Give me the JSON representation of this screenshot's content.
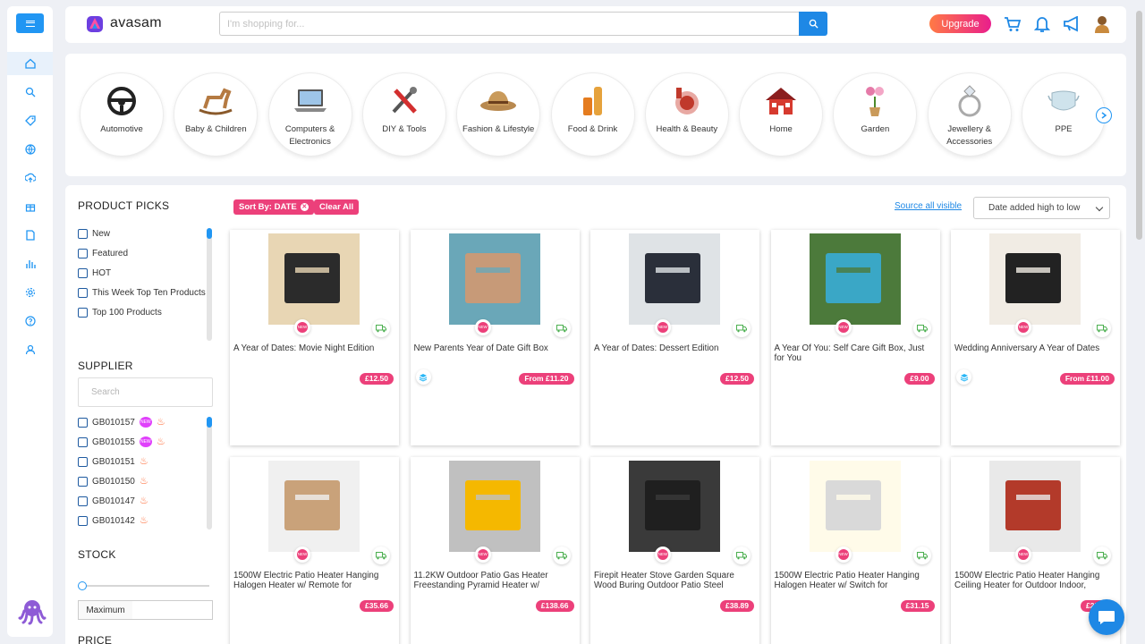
{
  "header": {
    "logo": "avasam",
    "search_placeholder": "I'm shopping for...",
    "upgrade": "Upgrade",
    "accent": "#1e88e5"
  },
  "nav_icons": [
    "home-icon",
    "search-icon",
    "tag-icon",
    "globe-icon",
    "upload-icon",
    "gift-icon",
    "document-icon",
    "chart-icon",
    "gear-icon",
    "help-icon",
    "user-icon"
  ],
  "categories": [
    {
      "label": "Automotive",
      "icon": "steering-wheel"
    },
    {
      "label": "Baby & Children",
      "icon": "rocking-horse"
    },
    {
      "label": "Computers & Electronics",
      "icon": "laptop"
    },
    {
      "label": "DIY & Tools",
      "icon": "tools"
    },
    {
      "label": "Fashion & Lifestyle",
      "icon": "hat"
    },
    {
      "label": "Food & Drink",
      "icon": "drinks"
    },
    {
      "label": "Health & Beauty",
      "icon": "cosmetics"
    },
    {
      "label": "Home",
      "icon": "house"
    },
    {
      "label": "Garden",
      "icon": "flowers"
    },
    {
      "label": "Jewellery & Accessories",
      "icon": "ring"
    },
    {
      "label": "PPE",
      "icon": "face-mask"
    }
  ],
  "filters": {
    "picks_title": "PRODUCT PICKS",
    "picks": [
      "New",
      "Featured",
      "HOT",
      "This Week Top Ten Products",
      "Top 100 Products"
    ],
    "supplier_title": "SUPPLIER",
    "supplier_search_placeholder": "Search",
    "suppliers": [
      {
        "code": "GB010157",
        "new": true
      },
      {
        "code": "GB010155",
        "new": true
      },
      {
        "code": "GB010151",
        "new": false
      },
      {
        "code": "GB010150",
        "new": false
      },
      {
        "code": "GB010147",
        "new": false
      },
      {
        "code": "GB010142",
        "new": false
      }
    ],
    "new_badge": "NEW",
    "stock_title": "STOCK",
    "maximum_label": "Maximum",
    "price_title": "PRICE"
  },
  "toolbar": {
    "sort_chip": "Sort By: DATE",
    "clear_all": "Clear All",
    "source_all": "Source all visible",
    "sort_value": "Date added high to low"
  },
  "products": [
    {
      "title": "A Year of Dates: Movie Night Edition",
      "price": "£12.50",
      "variants": false,
      "colors": [
        "#2b2b2b",
        "#e8d6b4"
      ]
    },
    {
      "title": "New Parents Year of Date Gift Box",
      "price": "From £11.20",
      "variants": true,
      "colors": [
        "#c79a78",
        "#6aa7b8"
      ]
    },
    {
      "title": "A Year of Dates: Dessert Edition",
      "price": "£12.50",
      "variants": false,
      "colors": [
        "#2a2f3a",
        "#dfe3e6"
      ]
    },
    {
      "title": "A Year Of You: Self Care Gift Box, Just for You",
      "price": "£9.00",
      "variants": false,
      "colors": [
        "#3aa7c6",
        "#4c7a3b"
      ]
    },
    {
      "title": "Wedding Anniversary A Year of Dates",
      "price": "From £11.00",
      "variants": true,
      "colors": [
        "#222222",
        "#f1ece4"
      ]
    },
    {
      "title": "1500W Electric Patio Heater Hanging Halogen Heater w/ Remote for",
      "price": "£35.66",
      "variants": false,
      "colors": [
        "#c9a27a",
        "#f0f0f0"
      ]
    },
    {
      "title": "11.2KW Outdoor Patio Gas Heater Freestanding Pyramid Heater w/",
      "price": "£138.66",
      "variants": false,
      "colors": [
        "#f5b800",
        "#c0c0c0"
      ]
    },
    {
      "title": "Firepit Heater Stove Garden Square Wood Buring Outdoor Patio Steel",
      "price": "£38.89",
      "variants": false,
      "colors": [
        "#1f1f1f",
        "#3a3a3a"
      ]
    },
    {
      "title": "1500W Electric Patio Heater Hanging Halogen Heater w/ Switch for",
      "price": "£31.15",
      "variants": false,
      "colors": [
        "#d9d9d9",
        "#fffbe9"
      ]
    },
    {
      "title": "1500W Electric Patio Heater Hanging Ceiling Heater for Outdoor Indoor,",
      "price": "£25.97",
      "variants": false,
      "colors": [
        "#b33a2a",
        "#e9e9e9"
      ]
    }
  ]
}
